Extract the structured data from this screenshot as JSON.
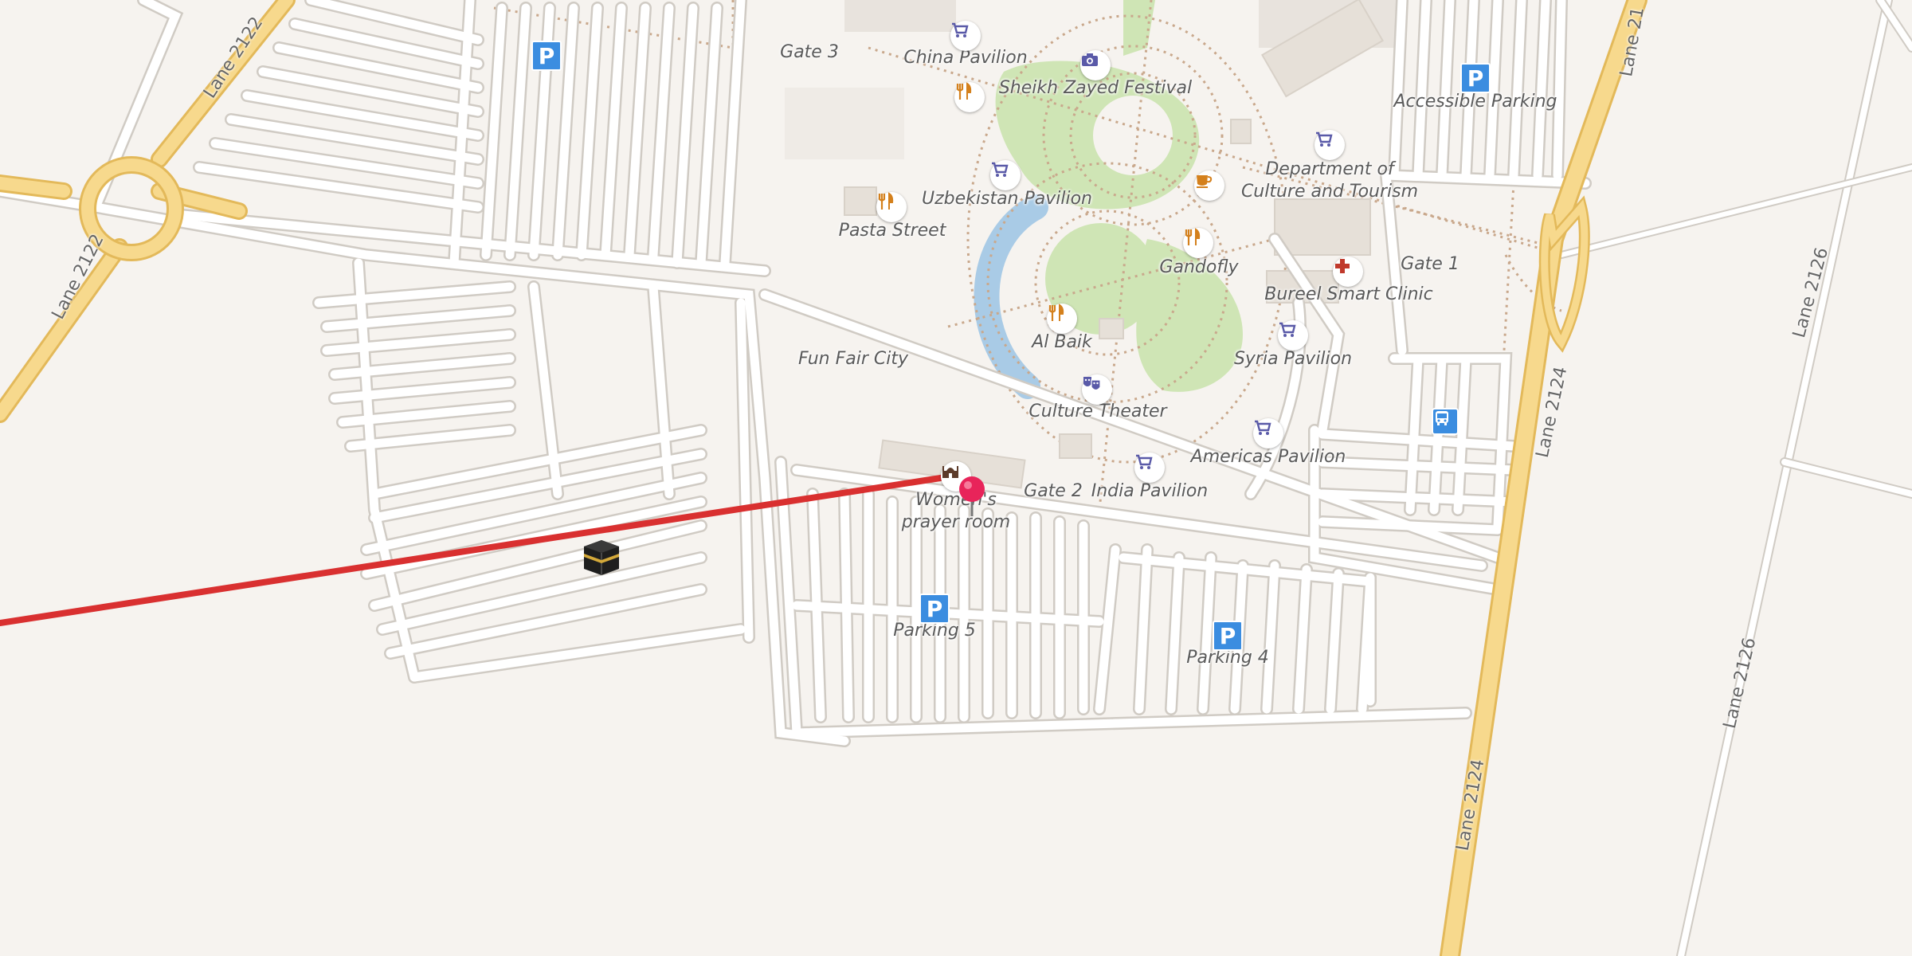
{
  "map": {
    "roads": [
      {
        "id": "lane-2122-top",
        "name": "Lane 2122"
      },
      {
        "id": "lane-2122-left",
        "name": "Lane 2122"
      },
      {
        "id": "lane-2124-top",
        "name": "Lane 2124"
      },
      {
        "id": "lane-2124-bottom",
        "name": "Lane 2124"
      },
      {
        "id": "lane-2126-top",
        "name": "Lane 2126"
      },
      {
        "id": "lane-2126-bottom",
        "name": "Lane 2126"
      },
      {
        "id": "lane-21-top-right",
        "name": "Lane 21"
      }
    ],
    "places": [
      {
        "id": "gate-3",
        "name": "Gate 3"
      },
      {
        "id": "gate-2",
        "name": "Gate 2"
      },
      {
        "id": "gate-1",
        "name": "Gate 1"
      },
      {
        "id": "china-pavilion",
        "name": "China Pavilion",
        "icon": "shopping-cart-icon"
      },
      {
        "id": "sheikh-zayed-festival",
        "name": "Sheikh Zayed Festival",
        "icon": "camera-icon"
      },
      {
        "id": "uzbekistan-pavilion",
        "name": "Uzbekistan Pavilion",
        "icon": "shopping-cart-icon"
      },
      {
        "id": "pasta-street",
        "name": "Pasta Street",
        "icon": "restaurant-icon"
      },
      {
        "id": "department-culture",
        "name": "Department of\nCulture and Tourism",
        "icon": "shopping-cart-icon"
      },
      {
        "id": "gandofly",
        "name": "Gandofly",
        "icon": "restaurant-icon"
      },
      {
        "id": "bureel-clinic",
        "name": "Bureel Smart Clinic",
        "icon": "medical-cross-icon"
      },
      {
        "id": "al-baik",
        "name": "Al Baik",
        "icon": "restaurant-icon"
      },
      {
        "id": "syria-pavilion",
        "name": "Syria Pavilion",
        "icon": "shopping-cart-icon"
      },
      {
        "id": "fun-fair-city",
        "name": "Fun Fair City"
      },
      {
        "id": "culture-theater",
        "name": "Culture Theater",
        "icon": "theater-masks-icon"
      },
      {
        "id": "americas-pavilion",
        "name": "Americas Pavilion",
        "icon": "shopping-cart-icon"
      },
      {
        "id": "india-pavilion",
        "name": "India Pavilion",
        "icon": "shopping-cart-icon"
      },
      {
        "id": "womens-prayer-room",
        "name": "Women's\nprayer room",
        "icon": "mosque-icon"
      },
      {
        "id": "accessible-parking",
        "name": "Accessible Parking",
        "icon": "parking-icon"
      },
      {
        "id": "parking-5",
        "name": "Parking 5",
        "icon": "parking-icon"
      },
      {
        "id": "parking-4",
        "name": "Parking 4",
        "icon": "parking-icon"
      }
    ],
    "parking_symbol": "P",
    "colors": {
      "background": "#f6f3ef",
      "road_outline": "#cfcac3",
      "road_fill": "#ffffff",
      "motorway": "#f7d98d",
      "motorway_outline": "#e3b95a",
      "park": "#cfe5b5",
      "water": "#a9cbe6",
      "qibla_line": "#d93030",
      "pin": "#e8245a",
      "parking": "#3b8de0",
      "poi_shop": "#5a5aa8",
      "poi_food": "#d4801c",
      "poi_medical": "#c0392b"
    },
    "qibla_line_label": "qibla-direction",
    "marker": "selected-location-pin"
  }
}
